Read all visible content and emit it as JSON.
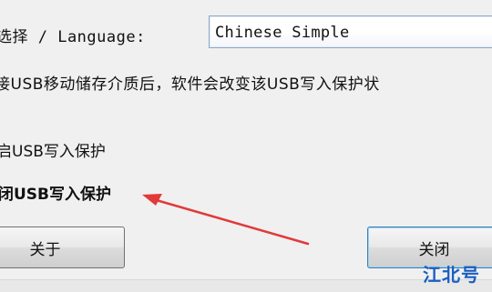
{
  "language": {
    "label": "选择 / Language:",
    "selected": "Chinese Simple"
  },
  "description": "接USB移动储存介质后，软件会改变该USB写入保护状",
  "options": {
    "enable_label": "启USB写入保护",
    "disable_label": "闭USB写入保护"
  },
  "buttons": {
    "about_label": "关于",
    "close_label": "关闭"
  },
  "watermark": "江北号",
  "colors": {
    "arrow": "#e03a3a",
    "watermark": "#1a5fc2",
    "close_button_border": "#3c7fb1"
  },
  "icons": {
    "annotation": "red-arrow-icon"
  }
}
